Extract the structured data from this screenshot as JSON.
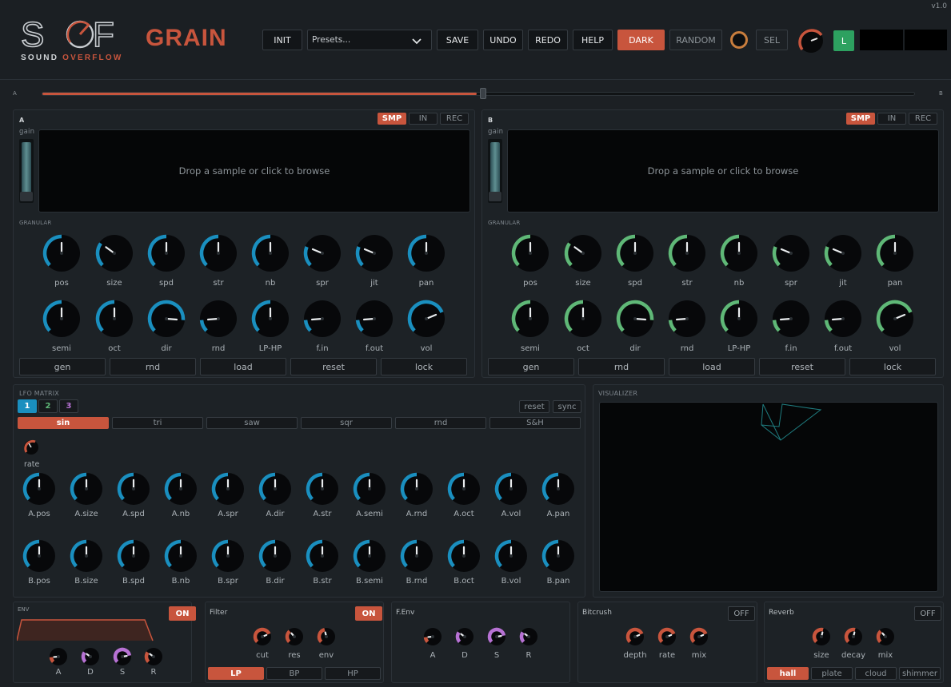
{
  "header": {
    "version": "v1.0",
    "logo_text": "SOF",
    "logo_sub_a": "SOUND",
    "logo_sub_b": "OVERFLOW",
    "plugin_name": "GRAIN",
    "buttons": {
      "init": "INIT",
      "save": "SAVE",
      "undo": "UNDO",
      "redo": "REDO",
      "help": "HELP",
      "dark": "DARK",
      "random": "RANDOM",
      "sel": "SEL",
      "l": "L"
    },
    "presets_placeholder": "Presets...",
    "colors": {
      "accent": "#c8553d",
      "blue": "#1a8fbf",
      "green": "#5fb877",
      "purple": "#b772d4",
      "l_button": "#2da160"
    }
  },
  "crossfader": {
    "left_label": "A",
    "right_label": "B",
    "value": 0.5
  },
  "engines": [
    {
      "name": "A",
      "source_tabs": [
        "SMP",
        "IN",
        "REC"
      ],
      "active_tab": "SMP",
      "gain_label": "gain",
      "drop_text": "Drop a sample or click to browse",
      "section_label": "GRANULAR",
      "knob_color": "#1a8fbf",
      "knobs_row1": [
        {
          "label": "pos",
          "value": 0.5
        },
        {
          "label": "size",
          "value": 0.3
        },
        {
          "label": "spd",
          "value": 0.5
        },
        {
          "label": "str",
          "value": 0.5
        },
        {
          "label": "nb",
          "value": 0.5
        },
        {
          "label": "spr",
          "value": 0.25
        },
        {
          "label": "jit",
          "value": 0.25
        },
        {
          "label": "pan",
          "value": 0.5
        }
      ],
      "knobs_row2": [
        {
          "label": "semi",
          "value": 0.5
        },
        {
          "label": "oct",
          "value": 0.5
        },
        {
          "label": "dir",
          "value": 0.85
        },
        {
          "label": "rnd",
          "value": 0.15
        },
        {
          "label": "LP-HP",
          "value": 0.5
        },
        {
          "label": "f.in",
          "value": 0.15
        },
        {
          "label": "f.out",
          "value": 0.15
        },
        {
          "label": "vol",
          "value": 0.75
        }
      ],
      "buttons": [
        "gen",
        "rnd",
        "load",
        "reset",
        "lock"
      ]
    },
    {
      "name": "B",
      "source_tabs": [
        "SMP",
        "IN",
        "REC"
      ],
      "active_tab": "SMP",
      "gain_label": "gain",
      "drop_text": "Drop a sample or click to browse",
      "section_label": "GRANULAR",
      "knob_color": "#5fb877",
      "knobs_row1": [
        {
          "label": "pos",
          "value": 0.5
        },
        {
          "label": "size",
          "value": 0.3
        },
        {
          "label": "spd",
          "value": 0.5
        },
        {
          "label": "str",
          "value": 0.5
        },
        {
          "label": "nb",
          "value": 0.5
        },
        {
          "label": "spr",
          "value": 0.25
        },
        {
          "label": "jit",
          "value": 0.25
        },
        {
          "label": "pan",
          "value": 0.5
        }
      ],
      "knobs_row2": [
        {
          "label": "semi",
          "value": 0.5
        },
        {
          "label": "oct",
          "value": 0.5
        },
        {
          "label": "dir",
          "value": 0.85
        },
        {
          "label": "rnd",
          "value": 0.15
        },
        {
          "label": "LP-HP",
          "value": 0.5
        },
        {
          "label": "f.in",
          "value": 0.15
        },
        {
          "label": "f.out",
          "value": 0.15
        },
        {
          "label": "vol",
          "value": 0.75
        }
      ],
      "buttons": [
        "gen",
        "rnd",
        "load",
        "reset",
        "lock"
      ]
    }
  ],
  "lfo": {
    "title": "LFO MATRIX",
    "tabs": [
      "1",
      "2",
      "3"
    ],
    "active_tab": "1",
    "reset": "reset",
    "sync": "sync",
    "shapes": [
      "sin",
      "tri",
      "saw",
      "sqr",
      "rnd",
      "S&H"
    ],
    "active_shape": "sin",
    "rate_label": "rate",
    "targets_a": [
      "A.pos",
      "A.size",
      "A.spd",
      "A.nb",
      "A.spr",
      "A.dir",
      "A.str",
      "A.semi",
      "A.rnd",
      "A.oct",
      "A.vol",
      "A.pan"
    ],
    "targets_b": [
      "B.pos",
      "B.size",
      "B.spd",
      "B.nb",
      "B.spr",
      "B.dir",
      "B.str",
      "B.semi",
      "B.rnd",
      "B.oct",
      "B.vol",
      "B.pan"
    ]
  },
  "visualizer": {
    "title": "VISUALIZER"
  },
  "env": {
    "title": "ENV",
    "state": "ON",
    "knobs": [
      "A",
      "D",
      "S",
      "R"
    ]
  },
  "filter": {
    "title": "Filter",
    "state": "ON",
    "knobs": [
      "cut",
      "res",
      "env"
    ],
    "modes": [
      "LP",
      "BP",
      "HP"
    ],
    "active_mode": "LP"
  },
  "fenv": {
    "title": "F.Env",
    "knobs": [
      "A",
      "D",
      "S",
      "R"
    ]
  },
  "bitcrush": {
    "title": "Bitcrush",
    "state": "OFF",
    "knobs": [
      "depth",
      "rate",
      "mix"
    ]
  },
  "reverb": {
    "title": "Reverb",
    "state": "OFF",
    "knobs": [
      "size",
      "decay",
      "mix"
    ],
    "modes": [
      "hall",
      "plate",
      "cloud",
      "shimmer"
    ],
    "active_mode": "hall"
  }
}
